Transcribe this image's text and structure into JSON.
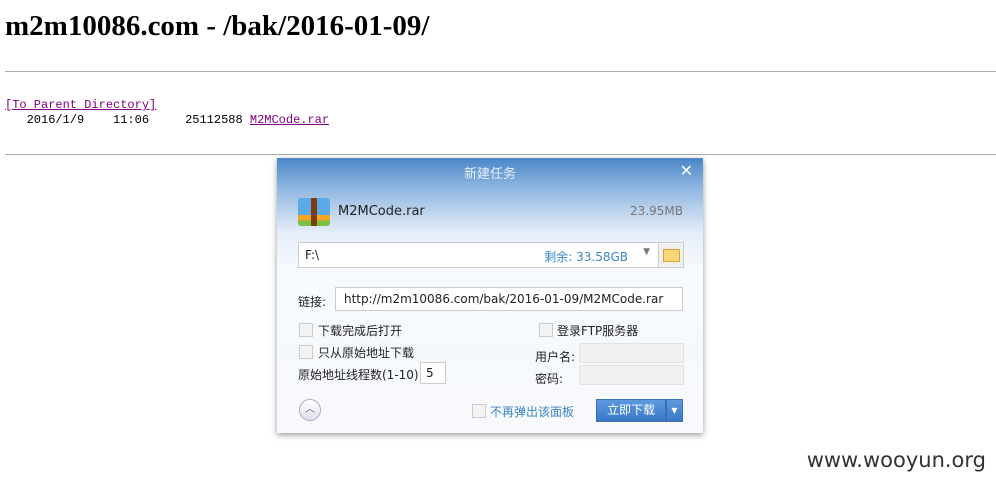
{
  "page": {
    "title": "m2m10086.com - /bak/2016-01-09/",
    "parent_link": "[To Parent Directory]",
    "files": [
      {
        "date": "2016/1/9",
        "time": "11:06",
        "size": "25112588",
        "name": "M2MCode.rar"
      }
    ]
  },
  "dialog": {
    "title": "新建任务",
    "file_name": "M2MCode.rar",
    "file_size": "23.95MB",
    "path": "F:\\",
    "free_space": "剩余: 33.58GB",
    "link_label": "链接:",
    "link_value": "http://m2m10086.com/bak/2016-01-09/M2MCode.rar",
    "open_after": "下载完成后打开",
    "only_origin": "只从原始地址下载",
    "threads_label": "原始地址线程数(1-10)",
    "threads_value": "5",
    "ftp_login": "登录FTP服务器",
    "username_label": "用户名:",
    "password_label": "密码:",
    "no_popup": "不再弹出该面板",
    "download_now": "立即下载"
  },
  "watermark": "www.wooyun.org"
}
